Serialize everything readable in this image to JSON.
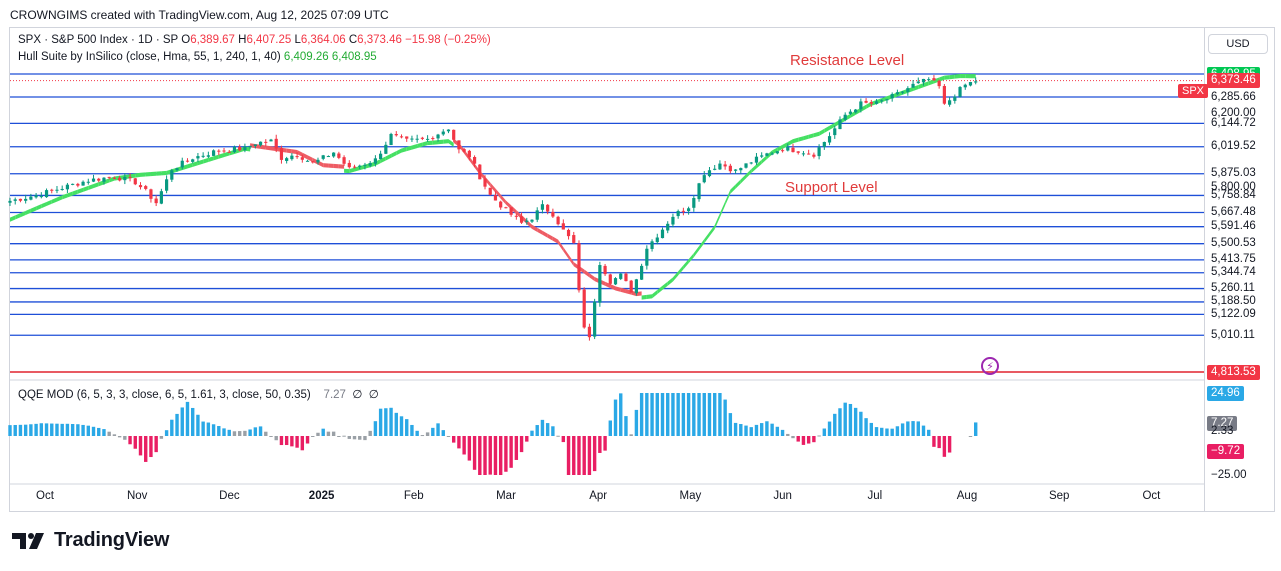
{
  "header": {
    "text": "CROWNGIMS created with TradingView.com, Aug 12, 2025 07:09 UTC"
  },
  "legend_price": {
    "symbol": "SPX · S&P 500 Index · 1D · SP",
    "o_label": "O",
    "o": "6,389.67",
    "h_label": "H",
    "h": "6,407.25",
    "l_label": "L",
    "l": "6,364.06",
    "c_label": "C",
    "c": "6,373.46",
    "change": "−15.98 (−0.25%)"
  },
  "legend_hull": {
    "name": "Hull Suite by InSilico (close, Hma, 55, 1, 240, 1, 40)",
    "v1": "6,409.26",
    "v2": "6,408.95"
  },
  "legend_qqe": {
    "name": "QQE MOD (6, 5, 3, 3, close, 6, 5, 1.61, 3, close, 50, 0.35)",
    "value": "7.27",
    "e1": "∅",
    "e2": "∅"
  },
  "currency": "USD",
  "annotations": {
    "resistance": "Resistance Level",
    "support": "Support Level"
  },
  "spx_tag": "SPX",
  "colors": {
    "bull": "#089981",
    "bear": "#f23645",
    "hull_up": "#45e063",
    "hull_down": "#ee5c64",
    "level_line": "#1e4fd8",
    "bottom_line": "#e0242f",
    "qqe_blue": "#2aa8e6",
    "qqe_gray": "#9aa0a6",
    "qqe_red": "#e91e63"
  },
  "icons": {
    "event_marker": "flash-icon",
    "logo": "tradingview-logo-icon"
  },
  "chart_data": {
    "type": "candlestick",
    "price_axis": {
      "range": [
        4813.53,
        6408.95
      ]
    },
    "level_labels": [
      {
        "text": "6,408.95",
        "style": "green-box"
      },
      {
        "text": "6,373.46",
        "style": "red-box"
      },
      {
        "text": "6,285.66",
        "style": "plain"
      },
      {
        "text": "6,200.00",
        "style": "plain"
      },
      {
        "text": "6,144.72",
        "style": "plain"
      },
      {
        "text": "6,019.52",
        "style": "plain"
      },
      {
        "text": "5,875.03",
        "style": "plain"
      },
      {
        "text": "5,800.00",
        "style": "plain"
      },
      {
        "text": "5,758.84",
        "style": "plain"
      },
      {
        "text": "5,667.48",
        "style": "plain"
      },
      {
        "text": "5,591.46",
        "style": "plain"
      },
      {
        "text": "5,500.53",
        "style": "plain"
      },
      {
        "text": "5,413.75",
        "style": "plain"
      },
      {
        "text": "5,344.74",
        "style": "plain"
      },
      {
        "text": "5,260.11",
        "style": "plain"
      },
      {
        "text": "5,188.50",
        "style": "plain"
      },
      {
        "text": "5,122.09",
        "style": "plain"
      },
      {
        "text": "5,010.11",
        "style": "plain"
      },
      {
        "text": "4,813.53",
        "style": "red-box"
      }
    ],
    "x_labels": [
      {
        "text": "Oct"
      },
      {
        "text": "Nov"
      },
      {
        "text": "Dec"
      },
      {
        "text": "2025",
        "bold": true
      },
      {
        "text": "Feb"
      },
      {
        "text": "Mar"
      },
      {
        "text": "Apr"
      },
      {
        "text": "May"
      },
      {
        "text": "Jun"
      },
      {
        "text": "Jul"
      },
      {
        "text": "Aug"
      },
      {
        "text": "Sep"
      },
      {
        "text": "Oct"
      }
    ],
    "close_path": [
      [
        0,
        5730
      ],
      [
        5,
        5760
      ],
      [
        10,
        5800
      ],
      [
        15,
        5840
      ],
      [
        20,
        5860
      ],
      [
        24,
        5830
      ],
      [
        26,
        5780
      ],
      [
        28,
        5720
      ],
      [
        31,
        5900
      ],
      [
        35,
        5960
      ],
      [
        40,
        6000
      ],
      [
        45,
        6010
      ],
      [
        47,
        6040
      ],
      [
        50,
        6050
      ],
      [
        52,
        5960
      ],
      [
        55,
        5980
      ],
      [
        58,
        5930
      ],
      [
        62,
        5990
      ],
      [
        65,
        5900
      ],
      [
        70,
        5950
      ],
      [
        73,
        6080
      ],
      [
        76,
        6050
      ],
      [
        80,
        6060
      ],
      [
        84,
        6120
      ],
      [
        86,
        6000
      ],
      [
        88,
        5970
      ],
      [
        90,
        5860
      ],
      [
        92,
        5760
      ],
      [
        95,
        5680
      ],
      [
        98,
        5610
      ],
      [
        100,
        5640
      ],
      [
        102,
        5700
      ],
      [
        104,
        5660
      ],
      [
        106,
        5570
      ],
      [
        108,
        5500
      ],
      [
        109,
        5240
      ],
      [
        110,
        5060
      ],
      [
        111,
        4990
      ],
      [
        112,
        5200
      ],
      [
        113,
        5400
      ],
      [
        115,
        5300
      ],
      [
        117,
        5330
      ],
      [
        119,
        5250
      ],
      [
        120,
        5310
      ],
      [
        122,
        5480
      ],
      [
        125,
        5580
      ],
      [
        127,
        5650
      ],
      [
        130,
        5700
      ],
      [
        133,
        5880
      ],
      [
        136,
        5930
      ],
      [
        139,
        5890
      ],
      [
        142,
        5940
      ],
      [
        145,
        5980
      ],
      [
        148,
        6010
      ],
      [
        151,
        6000
      ],
      [
        154,
        5980
      ],
      [
        157,
        6080
      ],
      [
        160,
        6190
      ],
      [
        163,
        6250
      ],
      [
        166,
        6250
      ],
      [
        170,
        6300
      ],
      [
        173,
        6350
      ],
      [
        176,
        6380
      ],
      [
        178,
        6340
      ],
      [
        179,
        6240
      ],
      [
        181,
        6300
      ],
      [
        183,
        6350
      ],
      [
        185,
        6373
      ]
    ],
    "hull_path": [
      [
        0,
        5640
      ],
      [
        10,
        5760
      ],
      [
        20,
        5860
      ],
      [
        25,
        5880
      ],
      [
        30,
        5890
      ],
      [
        38,
        5960
      ],
      [
        45,
        6020
      ],
      [
        50,
        6000
      ],
      [
        55,
        5980
      ],
      [
        60,
        5910
      ],
      [
        65,
        5900
      ],
      [
        70,
        5940
      ],
      [
        75,
        6010
      ],
      [
        80,
        6050
      ],
      [
        84,
        6060
      ],
      [
        86,
        6020
      ],
      [
        90,
        5870
      ],
      [
        95,
        5710
      ],
      [
        100,
        5580
      ],
      [
        105,
        5500
      ],
      [
        108,
        5380
      ],
      [
        112,
        5300
      ],
      [
        116,
        5250
      ],
      [
        120,
        5220
      ],
      [
        123,
        5230
      ],
      [
        127,
        5320
      ],
      [
        131,
        5450
      ],
      [
        135,
        5600
      ],
      [
        138,
        5790
      ],
      [
        142,
        5900
      ],
      [
        146,
        6000
      ],
      [
        150,
        6060
      ],
      [
        155,
        6100
      ],
      [
        160,
        6180
      ],
      [
        165,
        6260
      ],
      [
        170,
        6310
      ],
      [
        175,
        6360
      ],
      [
        179,
        6400
      ],
      [
        182,
        6409
      ],
      [
        185,
        6408
      ]
    ],
    "hull_turns": [
      {
        "from": 0,
        "to": 45,
        "dir": "up"
      },
      {
        "from": 45,
        "to": 63,
        "dir": "down"
      },
      {
        "from": 63,
        "to": 84,
        "dir": "up"
      },
      {
        "from": 84,
        "to": 120,
        "dir": "down"
      },
      {
        "from": 120,
        "to": 185,
        "dir": "up"
      }
    ],
    "qqe": {
      "range": [
        -25,
        24.96
      ],
      "last_label": "7.27",
      "axis_labels": [
        {
          "text": "24.96",
          "style": "blue-box",
          "value": 24.96
        },
        {
          "text": "7.27",
          "style": "gray-box",
          "value": 7.27
        },
        {
          "text": "2.33",
          "style": "plain",
          "value": 2.33
        },
        {
          "text": "−9.72",
          "style": "red-box",
          "value": -9.72
        },
        {
          "text": "−25.00",
          "style": "plain",
          "value": -25.0
        }
      ]
    }
  }
}
